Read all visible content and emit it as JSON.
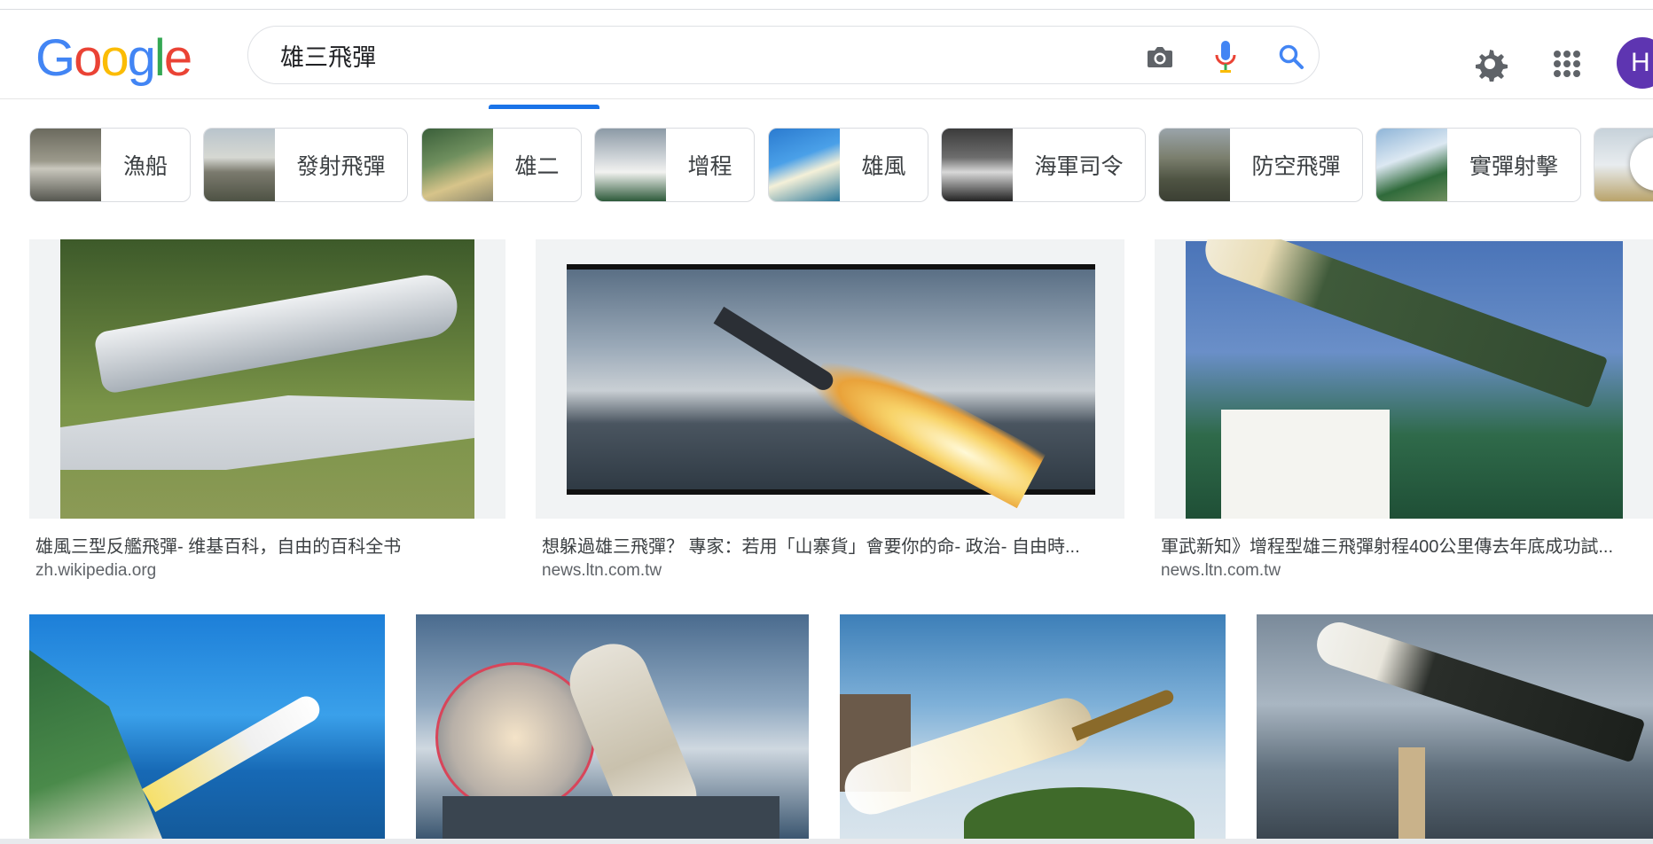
{
  "logo": {
    "letters": [
      "G",
      "o",
      "o",
      "g",
      "l",
      "e"
    ],
    "colors": [
      "#4285F4",
      "#EA4335",
      "#FBBC05",
      "#4285F4",
      "#34A853",
      "#EA4335"
    ]
  },
  "search": {
    "query": "雄三飛彈",
    "icons": [
      "camera-icon",
      "microphone-icon",
      "search-icon"
    ]
  },
  "header": {
    "settings_icon": "gear-icon",
    "apps_icon": "apps-grid-icon",
    "avatar_letter": "H"
  },
  "chips": [
    {
      "label": "漁船"
    },
    {
      "label": "發射飛彈"
    },
    {
      "label": "雄二"
    },
    {
      "label": "增程"
    },
    {
      "label": "雄風"
    },
    {
      "label": "海軍司令"
    },
    {
      "label": "防空飛彈"
    },
    {
      "label": "實彈射擊"
    },
    {
      "label": ""
    }
  ],
  "results_row1": [
    {
      "title": "雄風三型反艦飛彈- 维基百科，自由的百科全书",
      "site": "zh.wikipedia.org"
    },
    {
      "title": "想躲過雄三飛彈？ 專家：若用「山寨貨」會要你的命- 政治- 自由時...",
      "site": "news.ltn.com.tw"
    },
    {
      "title": "軍武新知》增程型雄三飛彈射程400公里傳去年底成功試...",
      "site": "news.ltn.com.tw"
    }
  ],
  "results_row2": [
    {
      "title": "",
      "site": ""
    },
    {
      "title": "",
      "site": ""
    },
    {
      "title": "",
      "site": ""
    },
    {
      "title": "",
      "site": ""
    }
  ],
  "colors": {
    "accent": "#1a73e8",
    "avatar": "#5e35b1"
  }
}
